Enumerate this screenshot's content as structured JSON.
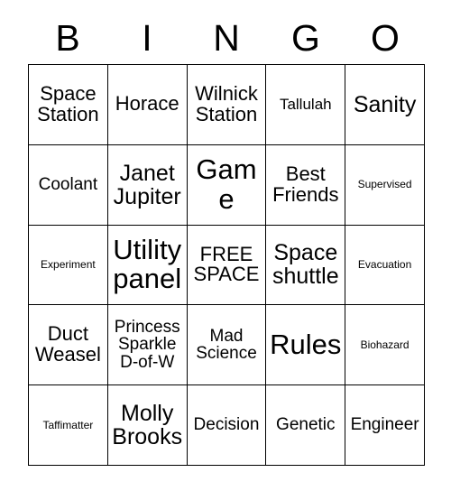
{
  "header": {
    "letters": [
      "B",
      "I",
      "N",
      "G",
      "O"
    ]
  },
  "grid": {
    "columns": 5,
    "rows": 5,
    "cells": [
      {
        "text": "Space\nStation",
        "size": "l"
      },
      {
        "text": "Horace",
        "size": "l"
      },
      {
        "text": "Wilnick\nStation",
        "size": "l"
      },
      {
        "text": "Tallulah",
        "size": "s"
      },
      {
        "text": "Sanity",
        "size": "xl"
      },
      {
        "text": "Coolant",
        "size": "m"
      },
      {
        "text": "Janet\nJupiter",
        "size": "xl"
      },
      {
        "text": "Game",
        "size": "xxl"
      },
      {
        "text": "Best\nFriends",
        "size": "l"
      },
      {
        "text": "Supervised",
        "size": "xs"
      },
      {
        "text": "Experiment",
        "size": "xs"
      },
      {
        "text": "Utility\npanel",
        "size": "xxl"
      },
      {
        "text": "FREE\nSPACE",
        "size": "l"
      },
      {
        "text": "Space\nshuttle",
        "size": "xl"
      },
      {
        "text": "Evacuation",
        "size": "xs"
      },
      {
        "text": "Duct\nWeasel",
        "size": "l"
      },
      {
        "text": "Princess\nSparkle\nD-of-W",
        "size": "m"
      },
      {
        "text": "Mad\nScience",
        "size": "m"
      },
      {
        "text": "Rules",
        "size": "xxl"
      },
      {
        "text": "Biohazard",
        "size": "xs"
      },
      {
        "text": "Taffimatter",
        "size": "xs"
      },
      {
        "text": "Molly\nBrooks",
        "size": "xl"
      },
      {
        "text": "Decision",
        "size": "m"
      },
      {
        "text": "Genetic",
        "size": "m"
      },
      {
        "text": "Engineer",
        "size": "m"
      }
    ]
  },
  "colors": {
    "background": "#ffffff",
    "border": "#000000",
    "text": "#000000"
  }
}
